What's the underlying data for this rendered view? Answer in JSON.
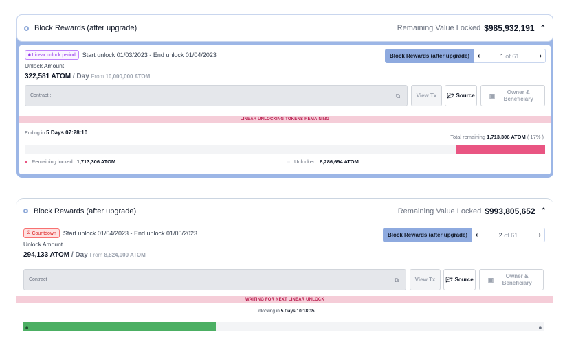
{
  "cards": [
    {
      "title": "Block Rewards (after upgrade)",
      "remaining_label": "Remaining Value Locked",
      "remaining_value": "$985,932,191",
      "badge": "Linear unlock period",
      "period": "Start unlock 01/03/2023 - End unlock 01/04/2023",
      "unlock_label": "Unlock Amount",
      "amount": "322,581 ATOM",
      "per_day": " / Day",
      "from_label": "From",
      "from_value": "10,000,000 ATOM",
      "contract_label": "Contract :",
      "pager_label": "Block Rewards (after upgrade)",
      "pager_current": "1",
      "pager_of": "of 61",
      "view_tx": "View Tx",
      "source": "Source",
      "owner": "Owner & Beneficiary",
      "banner": "LINEAR UNLOCKING TOKENS REMAINING",
      "ending_label": "Ending in",
      "ending_value": "5 Days 07:28:10",
      "total_label": "Total remaining",
      "total_value": "1,713,306 ATOM",
      "total_pct": "( 17% )",
      "locked_fraction": 0.17,
      "legend_locked_label": "Remaining locked",
      "legend_locked_value": "1,713,306 ATOM",
      "legend_unlocked_label": "Unlocked",
      "legend_unlocked_value": "8,286,694 ATOM"
    },
    {
      "title": "Block Rewards (after upgrade)",
      "remaining_label": "Remaining Value Locked",
      "remaining_value": "$993,805,652",
      "badge": "Countdown",
      "period": "Start unlock 01/04/2023 - End unlock 01/05/2023",
      "unlock_label": "Unlock Amount",
      "amount": "294,133 ATOM",
      "per_day": " / Day",
      "from_label": "From",
      "from_value": "8,824,000 ATOM",
      "contract_label": "Contract :",
      "pager_label": "Block Rewards (after upgrade)",
      "pager_current": "2",
      "pager_of": "of 61",
      "view_tx": "View Tx",
      "source": "Source",
      "owner": "Owner & Beneficiary",
      "banner": "WAITING FOR NEXT LINEAR UNLOCK",
      "unlocking_label": "Unlocking in",
      "unlocking_value": "5 Days 10:18:35",
      "countdown_fraction": 0.37
    }
  ],
  "colors": {
    "accent": "#8eaadf",
    "locked": "#e95582",
    "countdown": "#4caf63",
    "banner_bg": "#f5cdd8"
  },
  "icons": [
    "circle-dot-icon",
    "chevron-up-icon",
    "lock-icon",
    "copy-icon",
    "folder-icon",
    "id-card-icon",
    "chevron-left-icon",
    "chevron-right-icon",
    "alarm-icon"
  ]
}
